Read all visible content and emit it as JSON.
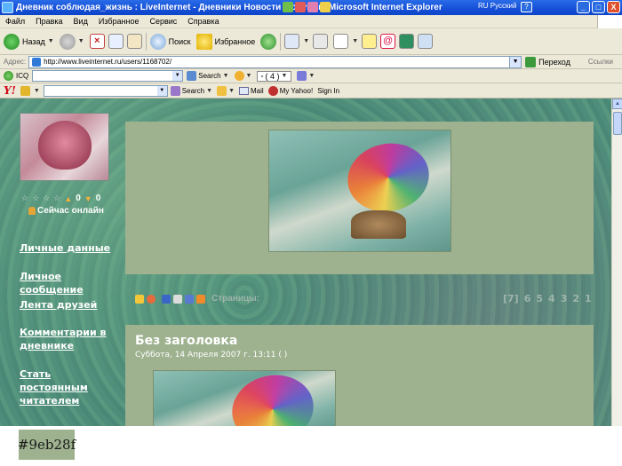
{
  "window": {
    "title": "Дневник соблюдая_жизнь : LiveInternet - Дневники Новости Форумы - Microsoft Internet Explorer",
    "language": "RU Русский",
    "help": "?",
    "minimize": "_",
    "maximize": "□",
    "close": "X"
  },
  "menu": [
    "Файл",
    "Правка",
    "Вид",
    "Избранное",
    "Сервис",
    "Справка"
  ],
  "toolbar": {
    "back": "Назад",
    "search": "Поиск",
    "favorites": "Избранное"
  },
  "address": {
    "label": "Адрес:",
    "url": "http://www.liveinternet.ru/users/1168702/",
    "go": "Переход",
    "links": "Ссылки"
  },
  "icq": {
    "label": "ICQ",
    "search": "Search",
    "mail_count": "( 4 )"
  },
  "yahoo": {
    "logo": "Y!",
    "search": "Search",
    "mail": "Mail",
    "my_yahoo": "My Yahoo!",
    "sign_in": "Sign In"
  },
  "profile": {
    "stars": [
      "☆",
      "☆",
      "☆",
      "☆"
    ],
    "likes": "0",
    "dislikes": "0",
    "status": "Сейчас онлайн"
  },
  "sidebar": {
    "links": [
      "Личные данные",
      "Личное сообщение",
      "Лента друзей",
      "Комментарии в дневнике",
      "Стать постоянным читателем"
    ]
  },
  "header": {
    "image_caption": "",
    "pages_label": "Страницы:"
  },
  "pager": [
    "[7]",
    "6",
    "5",
    "4",
    "3",
    "2",
    "1"
  ],
  "post": {
    "title": "Без заголовка",
    "date": "Суббота, 14 Апреля 2007 г. 13:11 (        )"
  },
  "swatch": {
    "label": "#9eb28f",
    "color": "#9eb28f"
  },
  "colors": {
    "panel": "#9eb28f",
    "background": "#4f8f7d",
    "titlebar": "#1650d8"
  }
}
